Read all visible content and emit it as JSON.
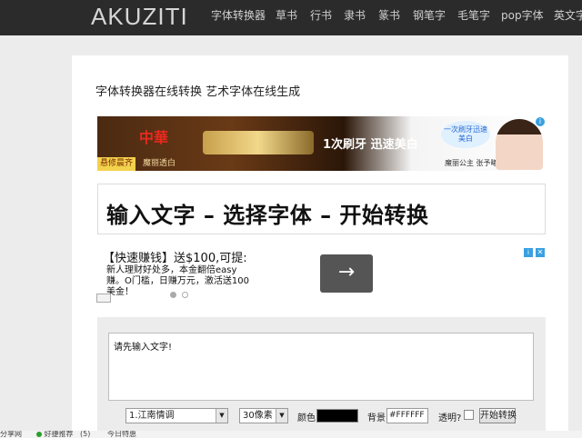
{
  "nav": {
    "logo": "AKUZITI",
    "items": [
      "字体转换器",
      "草书",
      "行书",
      "隶书",
      "篆书",
      "钢笔字",
      "毛笔字",
      "pop字体",
      "英文字"
    ]
  },
  "page": {
    "title": "字体转换器在线转换 艺术字体在线生成"
  },
  "ad_banner": {
    "brand": "中華",
    "tag": "悬修晨齐",
    "tag2": "魔丽透白",
    "slogan": "1次刷牙 迅速美白",
    "badge": "一次刷牙迅速美白",
    "caption": "魔丽公主 张予曦",
    "info": "i"
  },
  "steps_banner": {
    "text": "输入文字 – 选择字体 – 开始转换"
  },
  "ad2": {
    "title": "【快速赚钱】送$100,可提:",
    "desc": "新人理财好处多，本金翻倍easy赚。O门槛，日赚万元，激活送100美金！",
    "arrow": "→",
    "info": "i",
    "close": "✕"
  },
  "tool": {
    "textarea_value": "请先输入文字!",
    "font_select": "1.江南情调",
    "size_select": "30像素",
    "color_label": "颜色",
    "bg_label": "背景",
    "bg_value": "#FFFFFF",
    "transparent_label": "透明?",
    "convert_button": "开始转换"
  },
  "bottom_bar": {
    "item1": "分享网",
    "item2": "好捷推荐",
    "item3": "(5)",
    "item4": "今日特惠"
  },
  "colors": {
    "nav_bg": "#2b2b2b",
    "font_color": "#000000",
    "bg_color": "#FFFFFF"
  }
}
